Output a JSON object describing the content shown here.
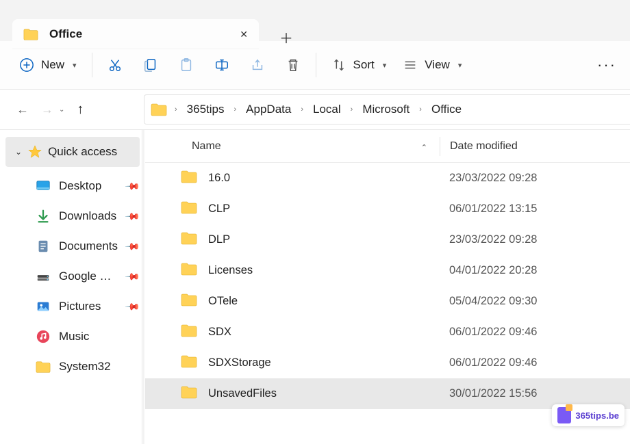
{
  "tab": {
    "title": "Office"
  },
  "toolbar": {
    "new": "New",
    "sort": "Sort",
    "view": "View"
  },
  "breadcrumb": [
    "365tips",
    "AppData",
    "Local",
    "Microsoft",
    "Office"
  ],
  "sidebar": {
    "quickaccess": "Quick access",
    "items": [
      {
        "label": "Desktop",
        "pin": true,
        "icon": "desktop"
      },
      {
        "label": "Downloads",
        "pin": true,
        "icon": "downloads"
      },
      {
        "label": "Documents",
        "pin": true,
        "icon": "documents"
      },
      {
        "label": "Google Drive",
        "pin": true,
        "icon": "gdrive"
      },
      {
        "label": "Pictures",
        "pin": true,
        "icon": "pictures"
      },
      {
        "label": "Music",
        "pin": false,
        "icon": "music"
      },
      {
        "label": "System32",
        "pin": false,
        "icon": "folder"
      }
    ]
  },
  "columns": {
    "name": "Name",
    "date": "Date modified"
  },
  "rows": [
    {
      "name": "16.0",
      "date": "23/03/2022 09:28"
    },
    {
      "name": "CLP",
      "date": "06/01/2022 13:15"
    },
    {
      "name": "DLP",
      "date": "23/03/2022 09:28"
    },
    {
      "name": "Licenses",
      "date": "04/01/2022 20:28"
    },
    {
      "name": "OTele",
      "date": "05/04/2022 09:30"
    },
    {
      "name": "SDX",
      "date": "06/01/2022 09:46"
    },
    {
      "name": "SDXStorage",
      "date": "06/01/2022 09:46"
    },
    {
      "name": "UnsavedFiles",
      "date": "30/01/2022 15:56",
      "selected": true
    }
  ],
  "badge": "365tips.be"
}
